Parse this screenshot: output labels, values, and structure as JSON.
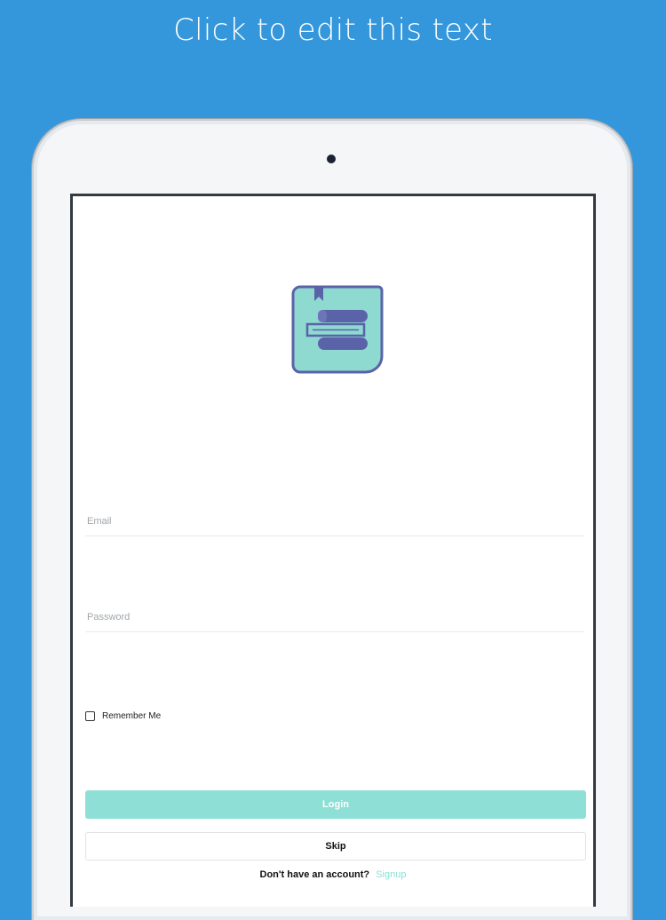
{
  "headline": "Click to edit this text",
  "login_form": {
    "email_placeholder": "Email",
    "password_placeholder": "Password",
    "remember_label": "Remember Me",
    "remember_checked": false,
    "login_label": "Login",
    "skip_label": "Skip",
    "signup_question": "Don't have an account?",
    "signup_link": "Signup"
  },
  "icons": {
    "logo": "books-bookmark-logo-icon",
    "camera": "front-camera"
  },
  "colors": {
    "background": "#3597db",
    "accent": "#8ee0d6",
    "logo_fill": "#8ed9d0",
    "logo_stroke": "#5a63a8"
  }
}
